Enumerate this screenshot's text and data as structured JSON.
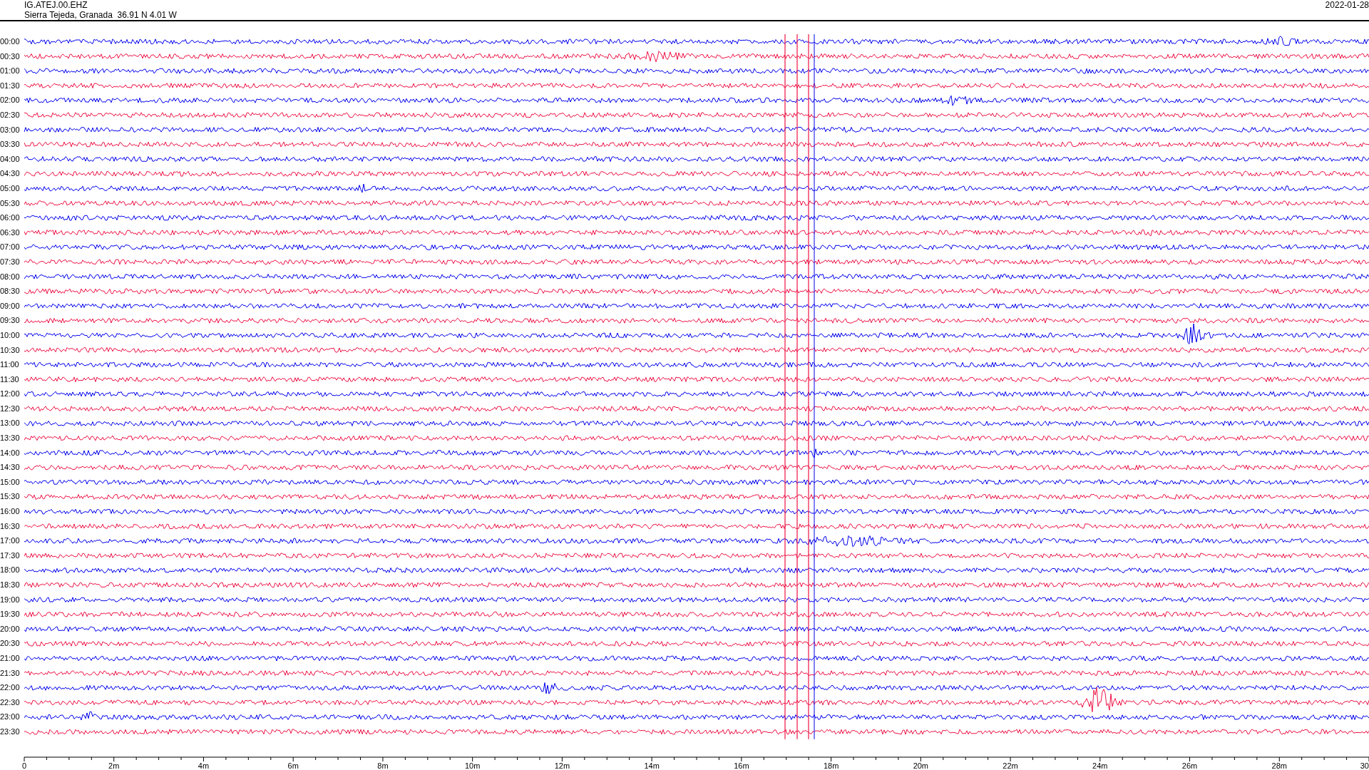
{
  "header": {
    "station": "IG.ATEJ.00.EHZ",
    "location": "Sierra Tejeda, Granada  36.91 N 4.01 W",
    "date": "2022-01-28"
  },
  "rows": [
    {
      "label": "00:00",
      "color": "#0000ee"
    },
    {
      "label": "00:30",
      "color": "#ee1144"
    },
    {
      "label": "01:00",
      "color": "#0000ee"
    },
    {
      "label": "01:30",
      "color": "#ee1144"
    },
    {
      "label": "02:00",
      "color": "#0000ee"
    },
    {
      "label": "02:30",
      "color": "#ee1144"
    },
    {
      "label": "03:00",
      "color": "#0000ee"
    },
    {
      "label": "03:30",
      "color": "#ee1144"
    },
    {
      "label": "04:00",
      "color": "#0000ee"
    },
    {
      "label": "04:30",
      "color": "#ee1144"
    },
    {
      "label": "05:00",
      "color": "#0000ee"
    },
    {
      "label": "05:30",
      "color": "#ee1144"
    },
    {
      "label": "06:00",
      "color": "#0000ee"
    },
    {
      "label": "06:30",
      "color": "#ee1144"
    },
    {
      "label": "07:00",
      "color": "#0000ee"
    },
    {
      "label": "07:30",
      "color": "#ee1144"
    },
    {
      "label": "08:00",
      "color": "#0000ee"
    },
    {
      "label": "08:30",
      "color": "#ee1144"
    },
    {
      "label": "09:00",
      "color": "#0000ee"
    },
    {
      "label": "09:30",
      "color": "#ee1144"
    },
    {
      "label": "10:00",
      "color": "#0000ee"
    },
    {
      "label": "10:30",
      "color": "#ee1144"
    },
    {
      "label": "11:00",
      "color": "#0000ee"
    },
    {
      "label": "11:30",
      "color": "#ee1144"
    },
    {
      "label": "12:00",
      "color": "#0000ee"
    },
    {
      "label": "12:30",
      "color": "#ee1144"
    },
    {
      "label": "13:00",
      "color": "#0000ee"
    },
    {
      "label": "13:30",
      "color": "#ee1144"
    },
    {
      "label": "14:00",
      "color": "#0000ee"
    },
    {
      "label": "14:30",
      "color": "#ee1144"
    },
    {
      "label": "15:00",
      "color": "#0000ee"
    },
    {
      "label": "15:30",
      "color": "#ee1144"
    },
    {
      "label": "16:00",
      "color": "#0000ee"
    },
    {
      "label": "16:30",
      "color": "#ee1144"
    },
    {
      "label": "17:00",
      "color": "#0000ee"
    },
    {
      "label": "17:30",
      "color": "#ee1144"
    },
    {
      "label": "18:00",
      "color": "#0000ee"
    },
    {
      "label": "18:30",
      "color": "#ee1144"
    },
    {
      "label": "19:00",
      "color": "#0000ee"
    },
    {
      "label": "19:30",
      "color": "#ee1144"
    },
    {
      "label": "20:00",
      "color": "#0000ee"
    },
    {
      "label": "20:30",
      "color": "#ee1144"
    },
    {
      "label": "21:00",
      "color": "#0000ee"
    },
    {
      "label": "21:30",
      "color": "#ee1144"
    },
    {
      "label": "22:00",
      "color": "#0000ee"
    },
    {
      "label": "22:30",
      "color": "#ee1144"
    },
    {
      "label": "23:00",
      "color": "#0000ee"
    },
    {
      "label": "23:30",
      "color": "#ee1144"
    }
  ],
  "axis": {
    "tick_labels": [
      "0",
      "2m",
      "4m",
      "6m",
      "8m",
      "10m",
      "12m",
      "14m",
      "16m",
      "18m",
      "20m",
      "22m",
      "24m",
      "26m",
      "28m",
      "30"
    ]
  }
}
